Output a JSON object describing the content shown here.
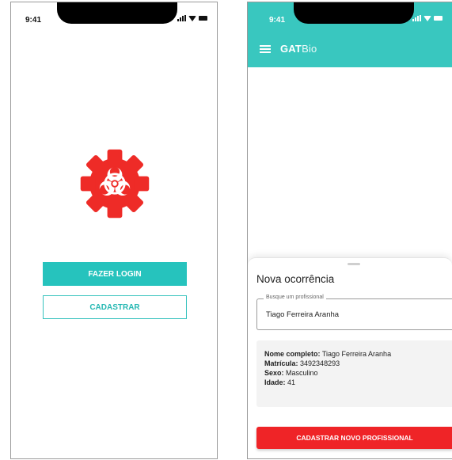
{
  "screens": {
    "login": {
      "status_time": "9:41",
      "login_button": "FAZER LOGIN",
      "register_button": "CADASTRAR",
      "logo_icon": "biohazard-gear-icon",
      "colors": {
        "accent": "#26c3bd",
        "logo": "#ee2b27"
      }
    },
    "ocorrencia": {
      "status_time": "9:41",
      "appbar": {
        "title_bold": "GAT",
        "title_light": "Bio",
        "color": "#39c7bf"
      },
      "sheet": {
        "title": "Nova ocorrência",
        "search": {
          "label": "Busque um profissional",
          "value": "Tiago Ferreira Aranha"
        },
        "details": [
          {
            "label": "Nome completo:",
            "value": "Tiago Ferreira Aranha"
          },
          {
            "label": "Matrícula:",
            "value": "3492348293"
          },
          {
            "label": "Sexo:",
            "value": "Masculino"
          },
          {
            "label": "Idade:",
            "value": "41"
          }
        ],
        "new_button": "CADASTRAR NOVO PROFISSIONAL",
        "button_color": "#ef2427"
      }
    }
  }
}
